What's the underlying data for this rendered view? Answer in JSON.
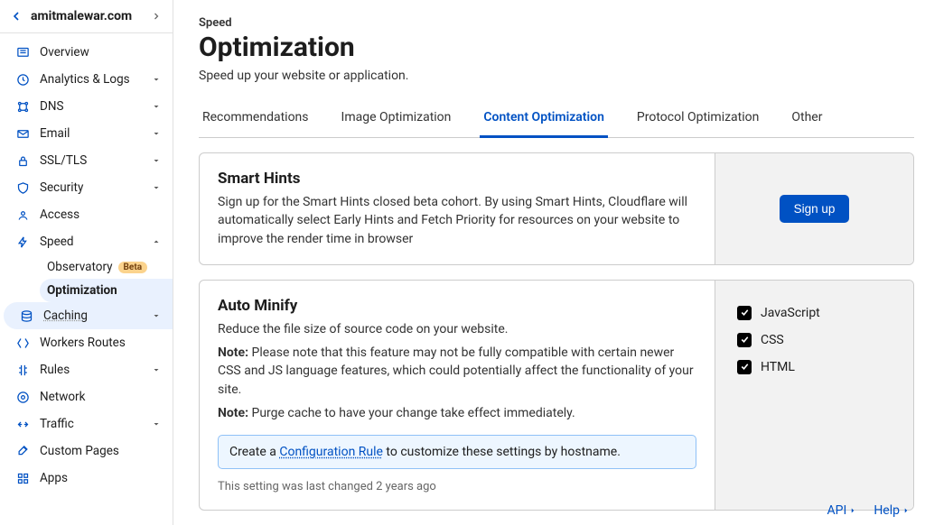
{
  "sidebar": {
    "domain": "amitmalewar.com",
    "items": [
      {
        "label": "Overview",
        "icon": "overview",
        "expandable": false
      },
      {
        "label": "Analytics & Logs",
        "icon": "analytics",
        "expandable": true
      },
      {
        "label": "DNS",
        "icon": "dns",
        "expandable": true
      },
      {
        "label": "Email",
        "icon": "email",
        "expandable": true
      },
      {
        "label": "SSL/TLS",
        "icon": "lock",
        "expandable": true
      },
      {
        "label": "Security",
        "icon": "shield",
        "expandable": true
      },
      {
        "label": "Access",
        "icon": "access",
        "expandable": false
      },
      {
        "label": "Speed",
        "icon": "speed",
        "expandable": true,
        "expanded": true,
        "children": [
          {
            "label": "Observatory",
            "badge": "Beta"
          },
          {
            "label": "Optimization",
            "active": true
          }
        ]
      },
      {
        "label": "Caching",
        "icon": "caching",
        "expandable": true,
        "highlight": true
      },
      {
        "label": "Workers Routes",
        "icon": "workers",
        "expandable": false
      },
      {
        "label": "Rules",
        "icon": "rules",
        "expandable": true
      },
      {
        "label": "Network",
        "icon": "network",
        "expandable": false
      },
      {
        "label": "Traffic",
        "icon": "traffic",
        "expandable": true
      },
      {
        "label": "Custom Pages",
        "icon": "custom",
        "expandable": false
      },
      {
        "label": "Apps",
        "icon": "apps",
        "expandable": false
      }
    ]
  },
  "page": {
    "breadcrumb": "Speed",
    "title": "Optimization",
    "subtitle": "Speed up your website or application."
  },
  "tabs": [
    {
      "label": "Recommendations"
    },
    {
      "label": "Image Optimization"
    },
    {
      "label": "Content Optimization",
      "active": true
    },
    {
      "label": "Protocol Optimization"
    },
    {
      "label": "Other"
    }
  ],
  "smartHints": {
    "title": "Smart Hints",
    "body": "Sign up for the Smart Hints closed beta cohort. By using Smart Hints, Cloudflare will automatically select Early Hints and Fetch Priority for resources on your website to improve the render time in browser",
    "button": "Sign up"
  },
  "autoMinify": {
    "title": "Auto Minify",
    "body": "Reduce the file size of source code on your website.",
    "noteLabel1": "Note:",
    "note1": " Please note that this feature may not be fully compatible with certain newer CSS and JS language features, which could potentially affect the functionality of your site.",
    "noteLabel2": "Note:",
    "note2": " Purge cache to have your change take effect immediately.",
    "hintPrefix": "Create a ",
    "hintLink": "Configuration Rule",
    "hintSuffix": " to customize these settings by hostname.",
    "meta": "This setting was last changed 2 years ago",
    "options": [
      {
        "label": "JavaScript",
        "checked": true
      },
      {
        "label": "CSS",
        "checked": true
      },
      {
        "label": "HTML",
        "checked": true
      }
    ]
  },
  "footer": {
    "api": "API",
    "help": "Help"
  }
}
